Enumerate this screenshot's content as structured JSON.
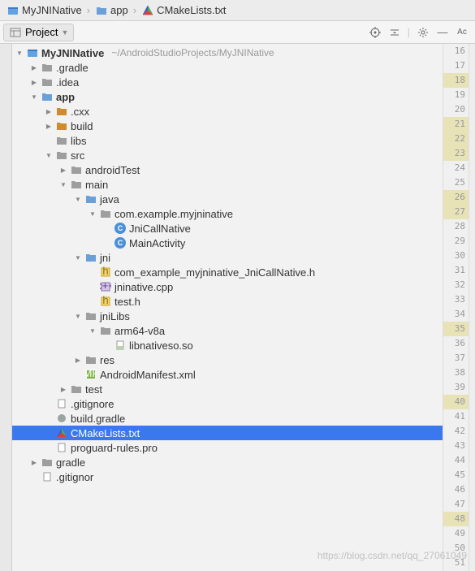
{
  "breadcrumb": {
    "items": [
      "MyJNINative",
      "app",
      "CMakeLists.txt"
    ]
  },
  "toolbar": {
    "project_label": "Project"
  },
  "tree": {
    "root": {
      "label": "MyJNINative",
      "path": "~/AndroidStudioProjects/MyJNINative"
    },
    "gradle_dot": ".gradle",
    "idea": ".idea",
    "app": "app",
    "cxx": ".cxx",
    "build": "build",
    "libs": "libs",
    "src": "src",
    "androidTest": "androidTest",
    "main": "main",
    "java": "java",
    "pkg": "com.example.myjninative",
    "c1": "JniCallNative",
    "c2": "MainActivity",
    "jni": "jni",
    "h1": "com_example_myjninative_JniCallNative.h",
    "cpp": "jninative.cpp",
    "h2": "test.h",
    "jniLibs": "jniLibs",
    "arch": "arm64-v8a",
    "so": "libnativeso.so",
    "res": "res",
    "manifest": "AndroidManifest.xml",
    "test": "test",
    "gitignore1": ".gitignore",
    "buildgradle": "build.gradle",
    "cmake": "CMakeLists.txt",
    "proguard": "proguard-rules.pro",
    "gradle": "gradle",
    "gitignore2": ".gitignore"
  },
  "gutter": {
    "start": 16,
    "end": 51,
    "highlights": [
      18,
      21,
      22,
      23,
      26,
      27,
      35,
      40,
      48
    ]
  },
  "watermark": "https://blog.csdn.net/qq_27061049"
}
